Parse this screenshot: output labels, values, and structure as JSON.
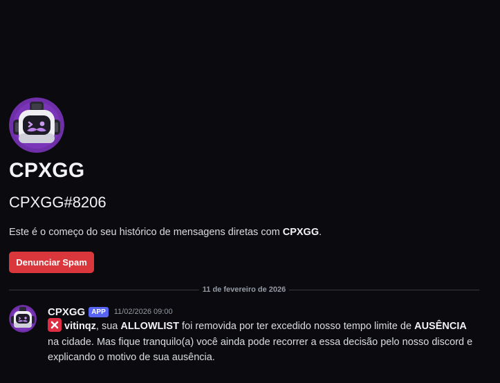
{
  "profile": {
    "display_name": "CPXGG",
    "username": "CPXGG#8206",
    "intro_prefix": "Este é o começo do seu histórico de mensagens diretas com ",
    "intro_name": "CPXGG",
    "intro_suffix": ".",
    "spam_button_label": "Denunciar Spam",
    "avatar_icon": "robot-avatar-icon"
  },
  "divider": {
    "date": "11 de fevereiro de 2026"
  },
  "message": {
    "author": "CPXGG",
    "badge": "APP",
    "timestamp": "11/02/2026 09:00",
    "emoji_icon": "x-mark-emoji-icon",
    "user": "vitinqz",
    "text_1": ", sua ",
    "allowlist": "ALLOWLIST",
    "text_2": " foi removida por ter excedido nosso tempo limite de ",
    "ausencia": "AUSÊNCIA",
    "text_3": " na cidade. Mas fique tranquilo(a) você ainda pode recorrer a essa decisão pelo nosso discord e explicando o motivo de sua ausência."
  },
  "colors": {
    "background": "#0b0a0f",
    "spam_button": "#da373c",
    "app_badge": "#5865f2",
    "avatar_purple": "#6f2fa8",
    "x_emoji": "#dd2e44"
  }
}
